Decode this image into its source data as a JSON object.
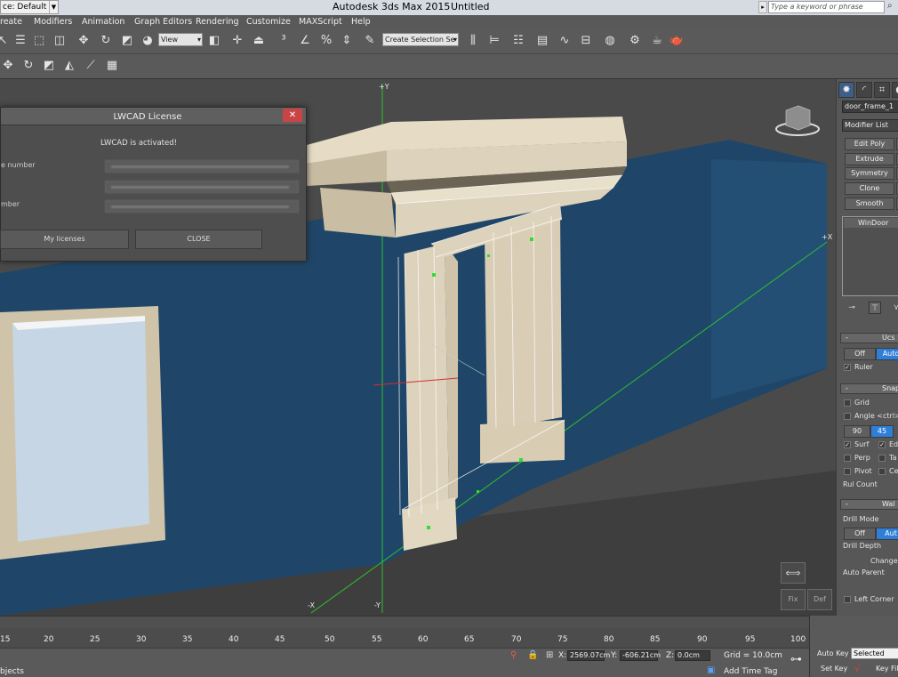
{
  "titlebar": {
    "workspace": "ce: Default",
    "app": "Autodesk 3ds Max  2015",
    "document": "Untitled",
    "search_placeholder": "Type a keyword or phrase"
  },
  "menu": [
    "reate",
    "Modifiers",
    "Animation",
    "Graph Editors",
    "Rendering",
    "Customize",
    "MAXScript",
    "Help"
  ],
  "toolbar": {
    "view_dropdown": "View",
    "selection_set_dropdown": "Create Selection Se"
  },
  "viewport": {
    "axis_labels": {
      "plus_y": "+Y",
      "plus_x": "+X",
      "minus_x": "-X",
      "minus_y": "-Y"
    },
    "buttons": {
      "fix": "Fix",
      "def": "Def"
    },
    "colors": {
      "wall": "#1f4668",
      "frame": "#ddd2bb",
      "axis_green": "#2fbf2f",
      "background": "#4a4a4a"
    }
  },
  "license_dialog": {
    "title": "LWCAD License",
    "close_glyph": "✕",
    "status": "LWCAD is activated!",
    "label_1": "e number",
    "label_2": "mber",
    "btn_licenses": "My licenses",
    "btn_close": "CLOSE"
  },
  "command_panel": {
    "object_name": "door_frame_1",
    "modifier_list": "Modifier List",
    "buttons": [
      "Edit Poly",
      "Extrude",
      "Symmetry",
      "Clone",
      "Smooth"
    ],
    "stack_item": "WinDoor",
    "ucs": {
      "title": "Ucs",
      "off": "Off",
      "auto": "Auto",
      "ruler": "Ruler"
    },
    "snap": {
      "title": "Snapp",
      "grid": "Grid",
      "angle": "Angle <ctrl>",
      "v90": "90",
      "v45": "45",
      "surf": "Surf",
      "edi": "Edi",
      "perp": "Perp",
      "ta": "Ta",
      "pivot": "Pivot",
      "ce": "Ce",
      "rul_count": "Rul Count"
    },
    "wall": {
      "title": "Wal",
      "drill_mode": "Drill Mode",
      "off": "Off",
      "auto": "Aut",
      "drill_depth": "Drill Depth",
      "change": "Change F",
      "auto_parent": "Auto Parent",
      "left_corner": "Left Corner"
    }
  },
  "timeline": {
    "ticks": [
      "15",
      "20",
      "25",
      "30",
      "35",
      "40",
      "45",
      "50",
      "55",
      "60",
      "65",
      "70",
      "75",
      "80",
      "85",
      "90",
      "95",
      "100"
    ]
  },
  "status": {
    "objects": "bjects",
    "x_label": "X:",
    "x_value": "2569.07cm",
    "y_label": "Y:",
    "y_value": "-606.21cm",
    "z_label": "Z:",
    "z_value": "0.0cm",
    "grid": "Grid = 10.0cm",
    "add_time_tag": "Add Time Tag"
  },
  "anim": {
    "auto_key": "Auto Key",
    "selected": "Selected",
    "set_key": "Set Key",
    "key_filters": "Key Filt"
  }
}
